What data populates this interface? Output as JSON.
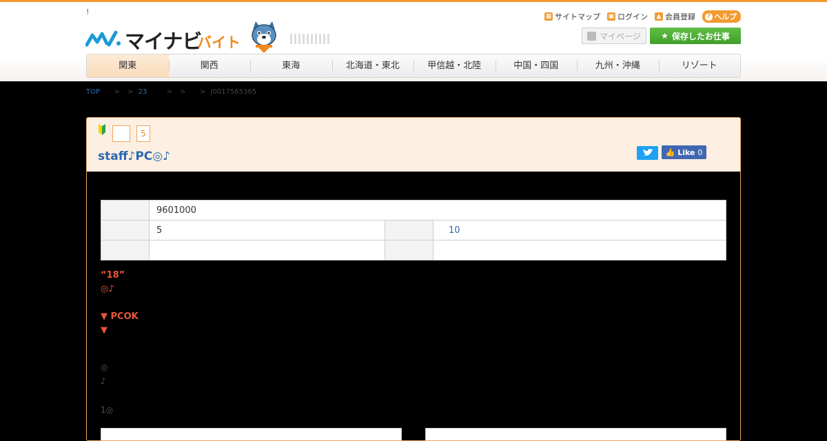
{
  "header": {
    "bang": "!",
    "logo_main": "マイナビ",
    "logo_sub": "バイト",
    "toplinks": {
      "sitemap": "サイトマップ",
      "login": "ログイン",
      "register": "会員登録",
      "help": "ヘルプ"
    },
    "mypage": "マイページ",
    "saved_jobs": "保存したお仕事"
  },
  "nav": {
    "items": [
      "関東",
      "関西",
      "東海",
      "北海道・東北",
      "甲信越・北陸",
      "中国・四国",
      "九州・沖縄",
      "リゾート"
    ],
    "active_index": 0
  },
  "breadcrumb": {
    "top": "TOP",
    "sep": ">",
    "crumb2": "23",
    "job_id": "J0017565365"
  },
  "job": {
    "badge_num": "5",
    "title": "staff♪PC◎♪",
    "fb_like": "Like",
    "fb_count": "0",
    "table": {
      "r1_value": "9601000",
      "r2_value": "5",
      "r2_value2": "10"
    },
    "red_line1": "“18”",
    "red_line2": "◎♪",
    "red_line3": "▼ PCOK",
    "red_line4": "▼",
    "gray_line1": "◎",
    "gray_line2": "♪",
    "gray_line3": "1◎"
  },
  "colors": {
    "accent_orange": "#f39a30",
    "link_blue": "#2a68b0",
    "highlight_red": "#e8563a",
    "save_green": "#4aab32",
    "card_bg": "#fdf0e2"
  }
}
